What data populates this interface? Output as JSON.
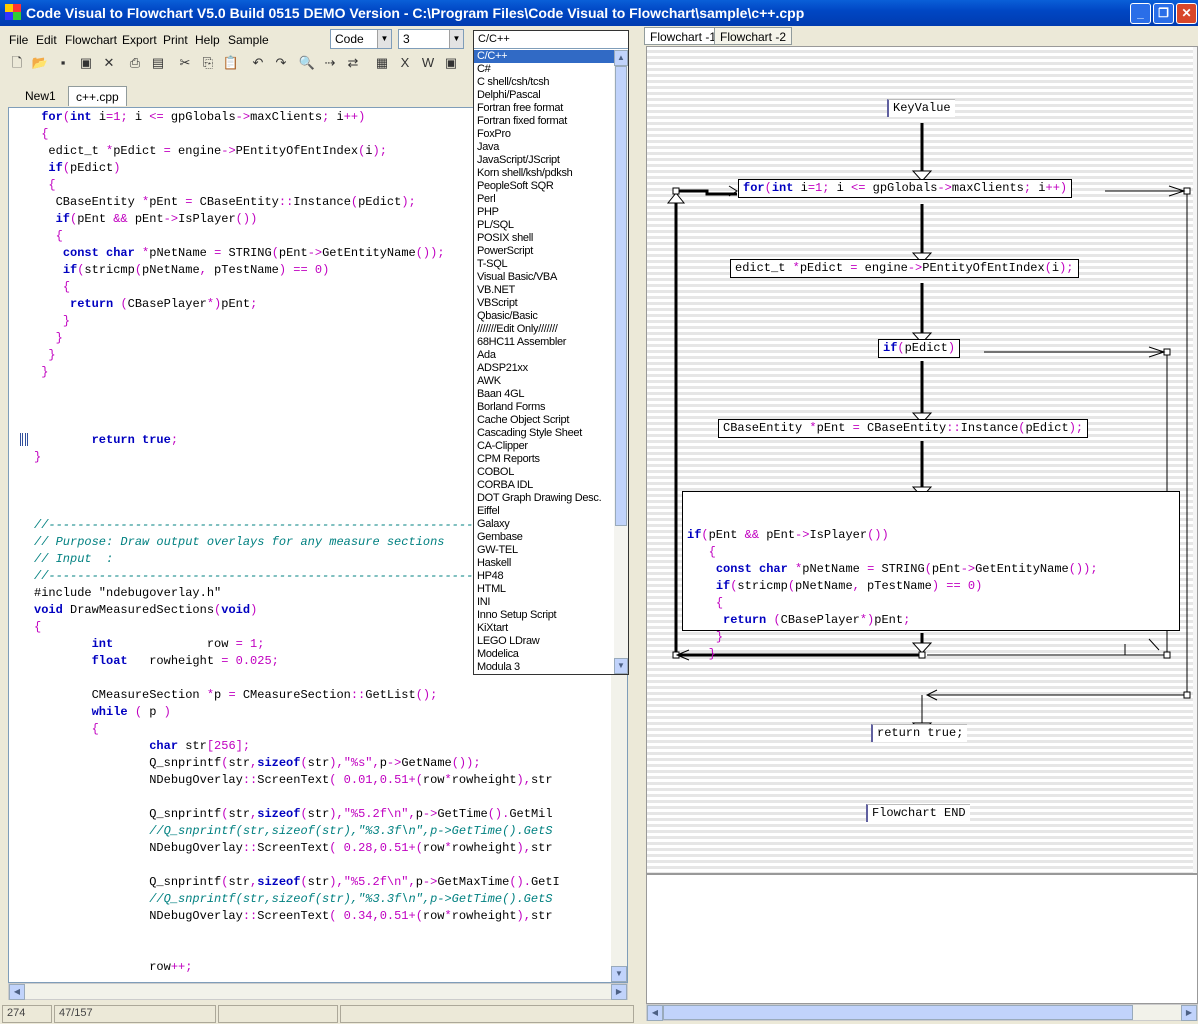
{
  "window": {
    "title": "Code Visual to Flowchart V5.0 Build 0515 DEMO Version - C:\\Program Files\\Code Visual to Flowchart\\sample\\c++.cpp"
  },
  "menu": [
    "File",
    "Edit",
    "Flowchart",
    "Export",
    "Print",
    "Help",
    "Sample"
  ],
  "combos": {
    "mode": "Code",
    "level": "3",
    "language": "C/C++"
  },
  "doc_tabs": [
    "New1",
    "c++.cpp"
  ],
  "flow_tabs": [
    "Flowchart -1",
    "Flowchart -2"
  ],
  "status": {
    "pos": "274",
    "total": "47/157"
  },
  "languages": [
    "C/C++",
    "C#",
    "C shell/csh/tcsh",
    "Delphi/Pascal",
    "Fortran free format",
    "Fortran fixed format",
    "FoxPro",
    "Java",
    "JavaScript/JScript",
    "Korn shell/ksh/pdksh",
    "PeopleSoft SQR",
    "Perl",
    "PHP",
    "PL/SQL",
    "POSIX shell",
    "PowerScript",
    "T-SQL",
    "Visual Basic/VBA",
    "VB.NET",
    "VBScript",
    "Qbasic/Basic",
    "///////Edit Only///////",
    "68HC11 Assembler",
    "Ada",
    "ADSP21xx",
    "AWK",
    "Baan 4GL",
    "Borland Forms",
    "Cache Object Script",
    "Cascading Style Sheet",
    "CA-Clipper",
    "CPM Reports",
    "COBOL",
    "CORBA IDL",
    "DOT Graph Drawing Desc.",
    "Eiffel",
    "Galaxy",
    "Gembase",
    "GW-TEL",
    "Haskell",
    "HP48",
    "HTML",
    "INI",
    "Inno Setup Script",
    "KiXtart",
    "LEGO LDraw",
    "Modelica",
    "Modula 3"
  ],
  "code": [
    " for(int i=1; i <= gpGlobals->maxClients; i++)",
    " {",
    "  edict_t *pEdict = engine->PEntityOfEntIndex(i);",
    "  if(pEdict)",
    "  {",
    "   CBaseEntity *pEnt = CBaseEntity::Instance(pEdict);",
    "   if(pEnt && pEnt->IsPlayer())",
    "   {",
    "    const char *pNetName = STRING(pEnt->GetEntityName());",
    "    if(stricmp(pNetName, pTestName) == 0)",
    "    {",
    "     return (CBasePlayer*)pEnt;",
    "    }",
    "   }",
    "  }",
    " }",
    "",
    "",
    "",
    "        return true;",
    "}",
    "",
    "",
    "",
    "//-----------------------------------------------------------------------",
    "// Purpose: Draw output overlays for any measure sections",
    "// Input  :",
    "//-----------------------------------------------------------------------",
    "#include \"ndebugoverlay.h\"",
    "void DrawMeasuredSections(void)",
    "{",
    "        int             row = 1;",
    "        float   rowheight = 0.025;",
    "",
    "        CMeasureSection *p = CMeasureSection::GetList();",
    "        while ( p )",
    "        {",
    "                char str[256];",
    "                Q_snprintf(str,sizeof(str),\"%s\",p->GetName());",
    "                NDebugOverlay::ScreenText( 0.01,0.51+(row*rowheight),str",
    "",
    "                Q_snprintf(str,sizeof(str),\"%5.2f\\n\",p->GetTime().GetMil",
    "                //Q_snprintf(str,sizeof(str),\"%3.3f\\n\",p->GetTime().GetS",
    "                NDebugOverlay::ScreenText( 0.28,0.51+(row*rowheight),str",
    "",
    "                Q_snprintf(str,sizeof(str),\"%5.2f\\n\",p->GetMaxTime().GetI",
    "                //Q_snprintf(str,sizeof(str),\"%3.3f\\n\",p->GetTime().GetS",
    "                NDebugOverlay::ScreenText( 0.34,0.51+(row*rowheight),str",
    "",
    "",
    "                row++;"
  ],
  "flow": {
    "start": "KeyValue",
    "loop": "for(int i=1; i <= gpGlobals->maxClients; i++)",
    "stmt1": "edict_t *pEdict = engine->PEntityOfEntIndex(i);",
    "cond1": "if(pEdict)",
    "stmt2": "CBaseEntity *pEnt = CBaseEntity::Instance(pEdict);",
    "block": [
      "if(pEnt && pEnt->IsPlayer())",
      "   {",
      "    const char *pNetName = STRING(pEnt->GetEntityName());",
      "    if(stricmp(pNetName, pTestName) == 0)",
      "    {",
      "     return (CBasePlayer*)pEnt;",
      "    }",
      "   }"
    ],
    "ret": "return true;",
    "end": "Flowchart END"
  }
}
